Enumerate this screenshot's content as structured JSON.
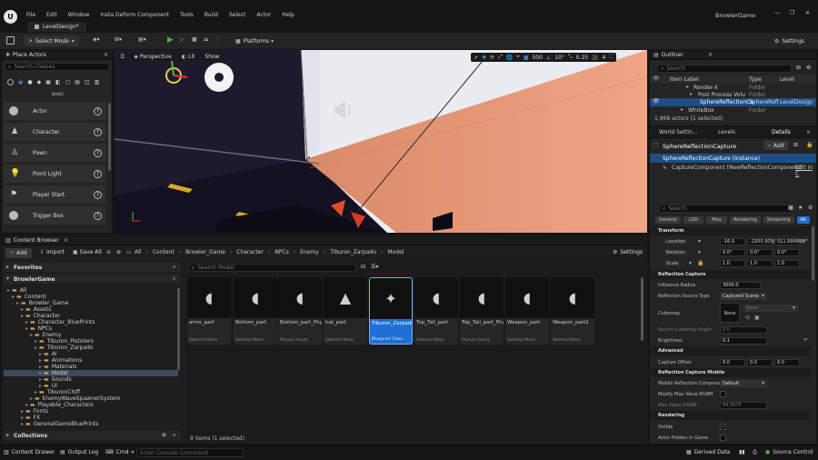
{
  "app": {
    "title": "BrowlerGame",
    "level_tab": "LevelDesign*"
  },
  "menu": [
    "File",
    "Edit",
    "Window",
    "Insta Deform Component",
    "Tools",
    "Build",
    "Select",
    "Actor",
    "Help"
  ],
  "toolbar": {
    "select_mode": "Select Mode",
    "platforms": "Platforms",
    "settings": "Settings"
  },
  "place_actors": {
    "tab": "Place Actors",
    "search_placeholder": "Search Classes",
    "category": "BASIC",
    "items": [
      "Actor",
      "Character",
      "Pawn",
      "Point Light",
      "Player Start",
      "Trigger Box"
    ]
  },
  "viewport": {
    "perspective": "Perspective",
    "lit": "Lit",
    "show": "Show",
    "grid": "500",
    "angle": "10°",
    "scale": "0.25",
    "camera": "4"
  },
  "outliner": {
    "tab": "Outliner",
    "search_placeholder": "Search",
    "col_label": "Item Label",
    "col_type": "Type",
    "col_level": "Level",
    "rows": [
      {
        "label": "Render-X",
        "type": "Folder"
      },
      {
        "label": "Post Process Volu",
        "type": "Folder"
      },
      {
        "label": "SphereReflectionCa",
        "type": "SphereRefl",
        "level": "LevelDesign"
      },
      {
        "label": "WhiteBox",
        "type": "Folder"
      }
    ],
    "status": "1,968 actors (1 selected)"
  },
  "details": {
    "tabs": [
      "World Settin...",
      "Levels",
      "Details"
    ],
    "actor_name": "SphereReflectionCapture",
    "add": "Add",
    "instance": "SphereReflectionCapture (Instance)",
    "component": "CaptureComponent (NewReflectionComponent)",
    "edit": "Edit in C",
    "search_placeholder": "Search",
    "filters": [
      "General",
      "LOD",
      "Misc",
      "Rendering",
      "Streaming",
      "All"
    ],
    "transform": {
      "title": "Transform",
      "location_label": "Location",
      "location": [
        "-16.0",
        "-2205.0058",
        "511.999999"
      ],
      "rotation_label": "Rotation",
      "rotation": [
        "0.0°",
        "0.0°",
        "0.0°"
      ],
      "scale_label": "Scale",
      "scale": [
        "1.0",
        "1.0",
        "1.0"
      ]
    },
    "reflection": {
      "title": "Reflection Capture",
      "influence_label": "Influence Radius",
      "influence": "3000.0",
      "source_label": "Reflection Source Type",
      "source": "Captured Scene",
      "cubemap_label": "Cubemap",
      "cubemap": "None",
      "cubemap_select": "None",
      "angle_label": "Source Cubemap Angle",
      "angle": "0.0",
      "brightness_label": "Brightness",
      "brightness": "0.1"
    },
    "advanced": {
      "title": "Advanced",
      "offset_label": "Capture Offset",
      "offset": [
        "0.0",
        "0.0",
        "0.0"
      ]
    },
    "mobile": {
      "title": "Reflection Capture Mobile",
      "compress_label": "Mobile Reflection Compress...",
      "compress": "Default",
      "modify_label": "Modify Max Value RGBM",
      "max_label": "Max Value RGBM",
      "max": "64.9975"
    },
    "rendering": {
      "title": "Rendering",
      "visible_label": "Visible",
      "hidden_label": "Actor Hidden In Game"
    }
  },
  "content_browser": {
    "tab": "Content Browser",
    "add": "Add",
    "import": "Import",
    "save_all": "Save All",
    "breadcrumb": [
      "All",
      "Content",
      "Browler_Game",
      "Character",
      "NPCs",
      "Enemy",
      "Tiburon_Zarpado",
      "Model"
    ],
    "settings": "Settings",
    "favorites": "Favorites",
    "project": "BrowlerGame",
    "search_placeholder": "Search Model",
    "status": "9 items (1 selected)",
    "collections": "Collections",
    "tree": [
      {
        "t": "All",
        "d": 0
      },
      {
        "t": "Content",
        "d": 1
      },
      {
        "t": "Browler_Game",
        "d": 2
      },
      {
        "t": "Assets",
        "d": 3
      },
      {
        "t": "Character",
        "d": 3
      },
      {
        "t": "Character_BluePrints",
        "d": 4
      },
      {
        "t": "NPCs",
        "d": 4
      },
      {
        "t": "Enemy",
        "d": 5
      },
      {
        "t": "Tiburon_Pistolero",
        "d": 6
      },
      {
        "t": "Tiburon_Zarpado",
        "d": 6
      },
      {
        "t": "AI",
        "d": 7
      },
      {
        "t": "Animations",
        "d": 7
      },
      {
        "t": "Materials",
        "d": 7
      },
      {
        "t": "Model",
        "d": 7
      },
      {
        "t": "Sounds",
        "d": 7
      },
      {
        "t": "UI",
        "d": 7
      },
      {
        "t": "TiburonChiff",
        "d": 6
      },
      {
        "t": "EnemyWaveSpawnerSystem",
        "d": 5
      },
      {
        "t": "Playable_Characters",
        "d": 4
      },
      {
        "t": "Fonts",
        "d": 3
      },
      {
        "t": "FX",
        "d": 3
      },
      {
        "t": "GeneralGameBluePrints",
        "d": 3
      }
    ],
    "assets": [
      {
        "name": "arms_part",
        "type": "Skeletal Mesh"
      },
      {
        "name": "Bottom_part",
        "type": "Skeletal Mesh"
      },
      {
        "name": "Bottom_part_PhysicsAsset",
        "type": "Physics Asset"
      },
      {
        "name": "hat_part",
        "type": "Skeletal Mesh"
      },
      {
        "name": "Tiburon_Zarpado_NPC_BP",
        "type": "Blueprint Class"
      },
      {
        "name": "Top_Tail_part",
        "type": "Skeletal Mesh"
      },
      {
        "name": "Top_Tail_part_PhysicsAsset",
        "type": "Physics Asset"
      },
      {
        "name": "Weapon_part",
        "type": "Skeletal Mesh"
      },
      {
        "name": "Weapon_part1",
        "type": "Skeletal Mesh"
      }
    ]
  },
  "statusbar": {
    "drawer": "Content Drawer",
    "output": "Output Log",
    "cmd": "Cmd",
    "console_placeholder": "Enter Console Command",
    "derived": "Derived Data",
    "source": "Source Control"
  }
}
